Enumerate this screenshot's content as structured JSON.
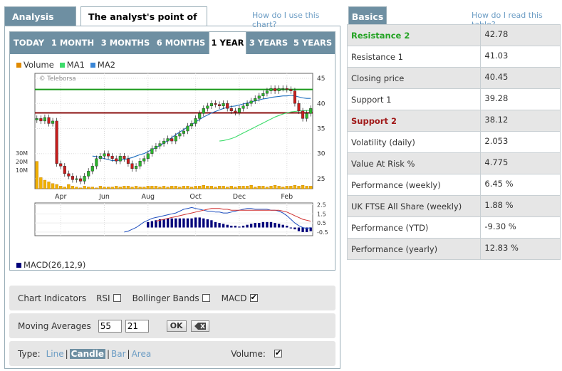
{
  "left_panel": {
    "tabs": [
      "Analysis Chart",
      "The analyst's point of view"
    ],
    "help_link": "How do I use this chart?",
    "periods": [
      "TODAY",
      "1 MONTH",
      "3 MONTHS",
      "6 MONTHS",
      "1 YEAR",
      "3 YEARS",
      "5 YEARS"
    ],
    "active_period": "1 YEAR",
    "legend": [
      {
        "name": "Volume",
        "color": "#e08a00"
      },
      {
        "name": "MA1",
        "color": "#3ddc6b"
      },
      {
        "name": "MA2",
        "color": "#3a86d6"
      }
    ],
    "watermark": "© Teleborsa",
    "macd_label": "MACD(26,12,9)",
    "macd_color": "#00007a"
  },
  "chart_data": {
    "type": "candlestick",
    "x_tick_labels": [
      "Apr",
      "Jun",
      "Aug",
      "Oct",
      "Dec",
      "Feb"
    ],
    "y_ticks": [
      25,
      30,
      35,
      40,
      45
    ],
    "ylim": [
      23,
      46
    ],
    "volume_ticks": [
      "30M",
      "20M",
      "10M"
    ],
    "macd_ticks": [
      "2.5",
      "1.5",
      "0.5",
      "-0.5"
    ],
    "resistance": 42.78,
    "support": 38.12,
    "close": [
      37,
      36.5,
      37.2,
      36,
      36.5,
      28,
      27.5,
      26,
      25.5,
      24.8,
      25,
      24.5,
      25.5,
      26.5,
      27.5,
      29,
      29.5,
      30,
      29.5,
      29,
      28.5,
      29.5,
      29,
      28,
      27,
      27.5,
      28.5,
      29,
      30,
      31,
      31.5,
      32,
      32.5,
      33,
      32.5,
      33.5,
      34,
      34.5,
      35.5,
      36,
      37,
      38,
      39,
      39.5,
      40,
      39.8,
      39.5,
      40,
      39,
      38.5,
      38.2,
      39,
      39.5,
      40,
      40.5,
      41,
      41.5,
      42,
      42.5,
      43,
      42.5,
      43,
      43,
      42.8,
      42.5,
      40,
      38.5,
      37,
      38,
      39
    ],
    "ma_slow": [
      null,
      null,
      null,
      null,
      null,
      null,
      null,
      null,
      null,
      null,
      null,
      null,
      null,
      null,
      29.5,
      29.4,
      29.2,
      29,
      28.8,
      28.6,
      28.6,
      28.7,
      28.8,
      29,
      29.2,
      29.5,
      29.8,
      30,
      30.4,
      30.8,
      31.2,
      31.6,
      32.1,
      32.6,
      33.2,
      33.8,
      34.3,
      34.8,
      35.3,
      35.8,
      36.3,
      36.8,
      37.3,
      37.7,
      38.1,
      38.4,
      38.7,
      39,
      39.2,
      39.4,
      39.5,
      39.7,
      39.9,
      40.1,
      40.3,
      40.5,
      40.7,
      40.9,
      41,
      41.2,
      41.3,
      41.4,
      41.5,
      41.5,
      41.6,
      41.5,
      41.3,
      41.1,
      41,
      41
    ],
    "ma_long": [
      null,
      null,
      null,
      null,
      null,
      null,
      null,
      null,
      null,
      null,
      null,
      null,
      null,
      null,
      null,
      null,
      null,
      null,
      null,
      null,
      null,
      null,
      null,
      null,
      null,
      null,
      null,
      null,
      null,
      null,
      null,
      null,
      null,
      null,
      null,
      null,
      null,
      null,
      null,
      null,
      null,
      null,
      null,
      null,
      null,
      null,
      32.5,
      32.6,
      32.8,
      33,
      33.3,
      33.7,
      34.1,
      34.5,
      34.9,
      35.3,
      35.7,
      36.1,
      36.5,
      36.9,
      37.3,
      37.6,
      37.9,
      38.1,
      38.3,
      38.4,
      38.5,
      38.5,
      38.6,
      38.6
    ],
    "volume": [
      3.2,
      1.3,
      1.0,
      0.8,
      0.6,
      0.5,
      0.3,
      0.2,
      0.5,
      0.3,
      0.2,
      0.1,
      0.3,
      0.2,
      0.2,
      0.1,
      0.3,
      0.2,
      0.2,
      0.2,
      0.3,
      0.2,
      0.3,
      0.3,
      0.2,
      0.3,
      0.2,
      0.2,
      0.3,
      0.3,
      0.3,
      0.2,
      0.3,
      0.2,
      0.3,
      0.3,
      0.2,
      0.3,
      0.3,
      0.2,
      0.3,
      0.3,
      0.4,
      0.3,
      0.3,
      0.2,
      0.3,
      0.3,
      0.2,
      0.3,
      0.2,
      0.3,
      0.3,
      0.3,
      0.4,
      0.2,
      0.3,
      0.3,
      0.2,
      0.3,
      0.4,
      0.3,
      0.2,
      0.3,
      0.3,
      0.4,
      0.3,
      0.4,
      0.3,
      0.3
    ],
    "macd_hist": [
      null,
      null,
      null,
      null,
      null,
      null,
      null,
      null,
      null,
      null,
      null,
      null,
      null,
      null,
      null,
      null,
      null,
      null,
      null,
      null,
      null,
      null,
      null,
      null,
      null,
      null,
      null,
      null,
      0.6,
      0.7,
      0.8,
      0.9,
      0.9,
      1.0,
      1.0,
      1.0,
      1.0,
      1.0,
      1.0,
      1.0,
      1.1,
      1.1,
      1.0,
      0.9,
      0.8,
      0.6,
      0.5,
      0.4,
      0.3,
      0.2,
      0.2,
      0.1,
      0.2,
      0.3,
      0.4,
      0.5,
      0.5,
      0.6,
      0.6,
      0.6,
      0.5,
      0.4,
      0.3,
      0.2,
      0.0,
      -0.2,
      -0.4,
      -0.5,
      -0.5,
      -0.4
    ],
    "macd_line": [
      null,
      null,
      null,
      null,
      null,
      null,
      null,
      null,
      null,
      null,
      null,
      null,
      null,
      null,
      null,
      null,
      null,
      null,
      null,
      null,
      null,
      null,
      -0.5,
      -0.4,
      -0.2,
      0,
      0.3,
      0.6,
      0.8,
      1.0,
      1.1,
      1.2,
      1.3,
      1.4,
      1.5,
      1.6,
      1.8,
      2.0,
      2.1,
      2.2,
      2.1,
      2.0,
      1.9,
      1.8,
      1.8,
      1.7,
      1.7,
      1.6,
      1.6,
      1.7,
      1.8,
      1.9,
      2.0,
      2.1,
      2.1,
      2.0,
      2.0,
      2.0,
      2.0,
      1.9,
      1.9,
      1.8,
      1.6,
      1.3,
      0.9,
      0.5,
      0.2,
      0,
      -0.1,
      0
    ],
    "signal_line": [
      null,
      null,
      null,
      null,
      null,
      null,
      null,
      null,
      null,
      null,
      null,
      null,
      null,
      null,
      null,
      null,
      null,
      null,
      null,
      null,
      null,
      null,
      null,
      null,
      null,
      null,
      null,
      null,
      null,
      null,
      0.7,
      0.8,
      0.9,
      1.0,
      1.1,
      1.2,
      1.3,
      1.4,
      1.5,
      1.6,
      1.7,
      1.8,
      1.9,
      2.0,
      2.1,
      2.1,
      2.1,
      2.0,
      2.0,
      1.9,
      1.9,
      1.9,
      1.9,
      1.9,
      1.9,
      1.9,
      1.9,
      1.9,
      1.9,
      1.9,
      1.9,
      1.9,
      1.8,
      1.7,
      1.5,
      1.3,
      1.1,
      0.9,
      0.8,
      0.7
    ]
  },
  "controls": {
    "indicators_label": "Chart Indicators",
    "rsi_label": "RSI",
    "rsi_checked": false,
    "bollinger_label": "Bollinger Bands",
    "bollinger_checked": false,
    "macd_label": "MACD",
    "macd_checked": true,
    "ma_label": "Moving Averages",
    "ma1_value": "55",
    "ma2_value": "21",
    "ok_label": "OK",
    "type_label": "Type:",
    "types": [
      "Line",
      "Candle",
      "Bar",
      "Area"
    ],
    "active_type": "Candle",
    "volume_label": "Volume:",
    "volume_checked": true
  },
  "right_panel": {
    "tab": "Basics",
    "help_link": "How do I read this table?",
    "rows": [
      {
        "label": "Resistance 2",
        "value": "42.78",
        "style": "green"
      },
      {
        "label": "Resistance 1",
        "value": "41.03",
        "style": ""
      },
      {
        "label": "Closing price",
        "value": "40.45",
        "style": ""
      },
      {
        "label": "Support 1",
        "value": "39.28",
        "style": ""
      },
      {
        "label": "Support 2",
        "value": "38.12",
        "style": "red"
      },
      {
        "label": "Volatility (daily)",
        "value": "2.053",
        "style": ""
      },
      {
        "label": "Value At Risk %",
        "value": "4.775",
        "style": ""
      },
      {
        "label": "Performance (weekly)",
        "value": "6.45 %",
        "style": ""
      },
      {
        "label": "UK FTSE All Share (weekly)",
        "value": "1.88 %",
        "style": ""
      },
      {
        "label": "Performance (YTD)",
        "value": "-9.30 %",
        "style": ""
      },
      {
        "label": "Performance (yearly)",
        "value": "12.83 %",
        "style": ""
      }
    ]
  }
}
